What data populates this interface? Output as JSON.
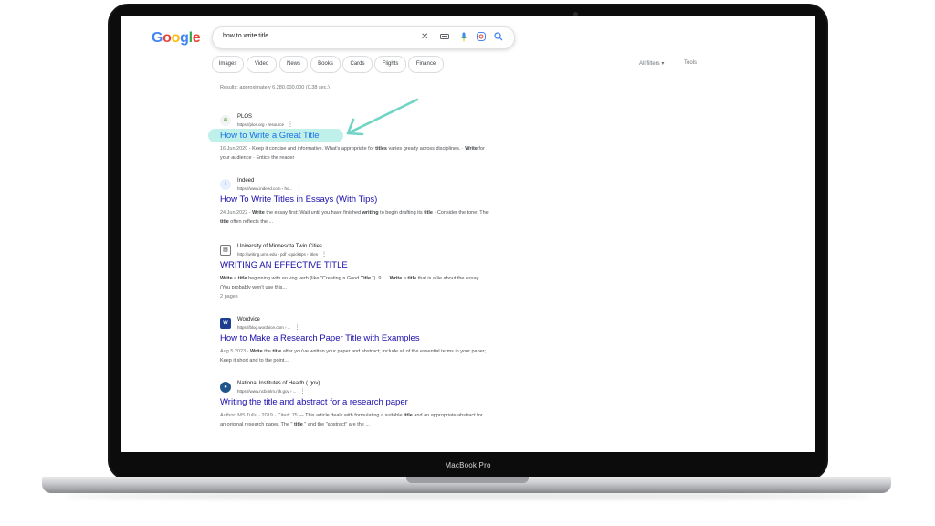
{
  "device": {
    "label": "MacBook Pro"
  },
  "google": {
    "logo": "Google",
    "search": {
      "query": "how to write title"
    },
    "chips": [
      "Images",
      "Video",
      "News",
      "Books",
      "Cards",
      "Flights",
      "Finance"
    ],
    "filters_label": "All filters",
    "tools_label": "Tools",
    "stats": "Results: approximately 6,280,000,000 (0.38 sec.)",
    "results": [
      {
        "site": "PLOS",
        "url": "https://plos.org › resource",
        "title": "How to Write a Great Title",
        "snippet_html": "<span class='date'>16 Jun 2020 - </span>Keep it concise and informative. What's appropriate for <b>titles</b> varies greatly across disciplines. · <b>Write</b> for your audience · Entice the reader",
        "favicon": "plos-icon",
        "highlighted": true
      },
      {
        "site": "Indeed",
        "url": "https://www.indeed.com › ho...",
        "title": "How To Write Titles in Essays (With Tips)",
        "snippet_html": "<span class='date'>24 Jun 2022 - </span><b>Write</b> the essay first: Wait until you have finished <b>writing</b> to begin drafting its <b>title</b> · Consider the tone: The <b>title</b> often reflects the ...",
        "favicon": "indeed-icon",
        "highlighted": false
      },
      {
        "site": "University of Minnesota Twin Cities",
        "url": "http://writing.umn.edu › pdf › quicktips › titles",
        "title": "WRITING AN EFFECTIVE TITLE",
        "snippet_html": "<b>Write</b> a <b>title</b> beginning with an -ing verb (like \"Creating a Good <b>Title</b> \"). 9. ... <b>Write</b> a <b>title</b> that is a lie about the essay. (You probably won't use this...<br><span class='date'>2 pages</span>",
        "favicon": "umn-icon",
        "highlighted": false
      },
      {
        "site": "Wordvice",
        "url": "https://blog.wordvice.com › ...",
        "title": "How to Make a Research Paper Title with Examples",
        "snippet_html": "<span class='date'>Aug 5 2023 - </span><b>Write</b> the <b>title</b> after you've written your paper and abstract; Include all of the essential terms in your paper; Keep it short and to the point....",
        "favicon": "wordvice-icon",
        "highlighted": false
      },
      {
        "site": "National Institutes of Health (.gov)",
        "url": "https://www.ncbi.nlm.nih.gov › ...",
        "title": "Writing the title and abstract for a research paper",
        "snippet_html": "<span class='date'>Author: MS Tullu · 2019 · Cited: 75 — </span>This article deals with formulating a suitable <b>title</b> and an appropriate abstract for an original research paper. The \" <b>title</b> \" and the \"abstract\" are the ...",
        "favicon": "nih-icon",
        "highlighted": false
      }
    ]
  },
  "colors": {
    "link": "#1a0dab",
    "arrow": "#6fd4c4",
    "highlight": "#bff0ea"
  }
}
